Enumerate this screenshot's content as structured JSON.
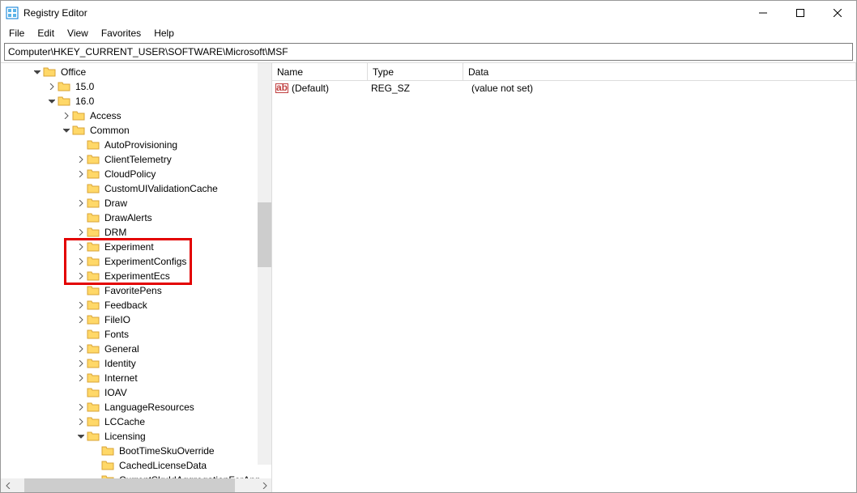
{
  "window": {
    "title": "Registry Editor"
  },
  "menu": {
    "file": "File",
    "edit": "Edit",
    "view": "View",
    "favorites": "Favorites",
    "help": "Help"
  },
  "address": "Computer\\HKEY_CURRENT_USER\\SOFTWARE\\Microsoft\\MSF",
  "columns": {
    "name": "Name",
    "type": "Type",
    "data": "Data"
  },
  "default_value": {
    "name": "(Default)",
    "type": "REG_SZ",
    "data": "(value not set)"
  },
  "tree": [
    {
      "indent": 38,
      "chev": "down",
      "label": "Office"
    },
    {
      "indent": 56,
      "chev": "right",
      "label": "15.0"
    },
    {
      "indent": 56,
      "chev": "down",
      "label": "16.0"
    },
    {
      "indent": 74,
      "chev": "right",
      "label": "Access"
    },
    {
      "indent": 74,
      "chev": "down",
      "label": "Common"
    },
    {
      "indent": 92,
      "chev": "",
      "label": "AutoProvisioning"
    },
    {
      "indent": 92,
      "chev": "right",
      "label": "ClientTelemetry"
    },
    {
      "indent": 92,
      "chev": "right",
      "label": "CloudPolicy"
    },
    {
      "indent": 92,
      "chev": "",
      "label": "CustomUIValidationCache"
    },
    {
      "indent": 92,
      "chev": "right",
      "label": "Draw"
    },
    {
      "indent": 92,
      "chev": "",
      "label": "DrawAlerts"
    },
    {
      "indent": 92,
      "chev": "right",
      "label": "DRM"
    },
    {
      "indent": 92,
      "chev": "right",
      "label": "Experiment",
      "hl": true
    },
    {
      "indent": 92,
      "chev": "right",
      "label": "ExperimentConfigs",
      "hl": true
    },
    {
      "indent": 92,
      "chev": "right",
      "label": "ExperimentEcs",
      "hl": true
    },
    {
      "indent": 92,
      "chev": "",
      "label": "FavoritePens"
    },
    {
      "indent": 92,
      "chev": "right",
      "label": "Feedback"
    },
    {
      "indent": 92,
      "chev": "right",
      "label": "FileIO"
    },
    {
      "indent": 92,
      "chev": "",
      "label": "Fonts"
    },
    {
      "indent": 92,
      "chev": "right",
      "label": "General"
    },
    {
      "indent": 92,
      "chev": "right",
      "label": "Identity"
    },
    {
      "indent": 92,
      "chev": "right",
      "label": "Internet"
    },
    {
      "indent": 92,
      "chev": "",
      "label": "IOAV"
    },
    {
      "indent": 92,
      "chev": "right",
      "label": "LanguageResources"
    },
    {
      "indent": 92,
      "chev": "right",
      "label": "LCCache"
    },
    {
      "indent": 92,
      "chev": "down",
      "label": "Licensing"
    },
    {
      "indent": 110,
      "chev": "",
      "label": "BootTimeSkuOverride"
    },
    {
      "indent": 110,
      "chev": "",
      "label": "CachedLicenseData"
    },
    {
      "indent": 110,
      "chev": "",
      "label": "CurrentSkuIdAggregationForApp"
    }
  ]
}
